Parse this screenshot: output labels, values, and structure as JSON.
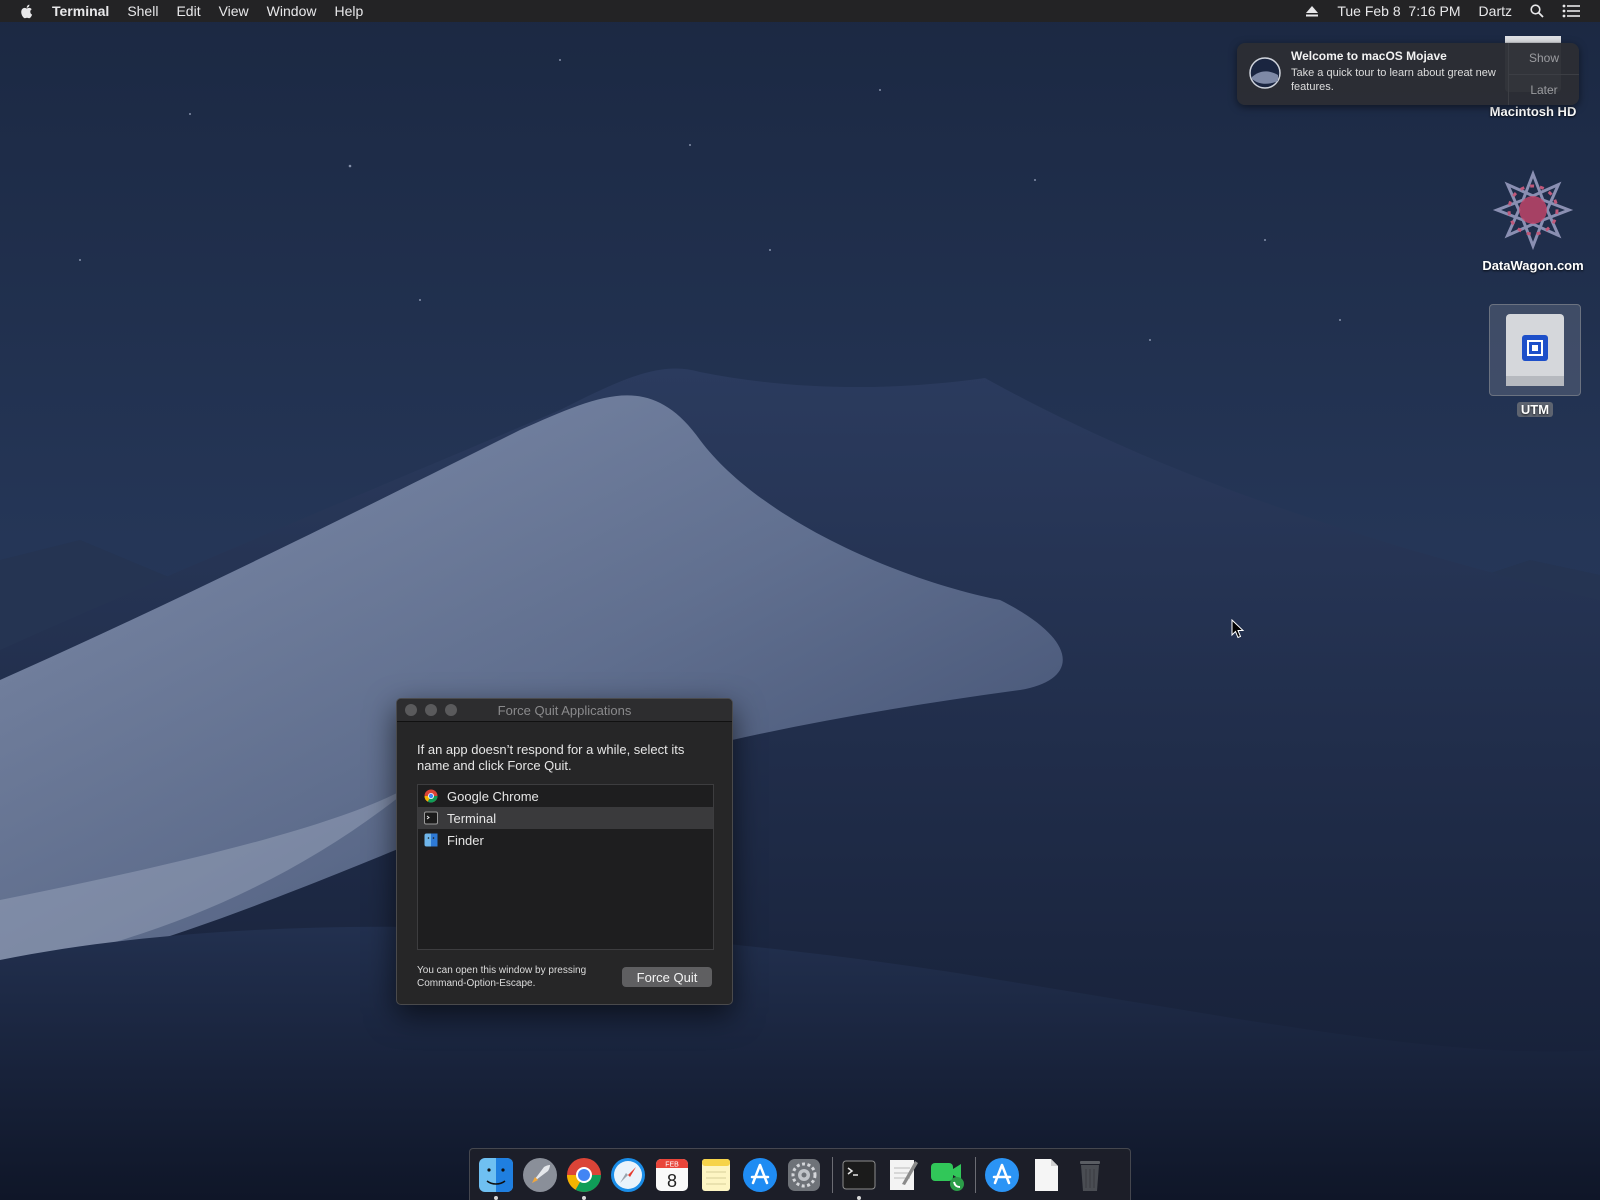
{
  "menubar": {
    "app_name": "Terminal",
    "menus": [
      "Shell",
      "Edit",
      "View",
      "Window",
      "Help"
    ],
    "clock": "Tue Feb 8  7:16 PM",
    "user": "Dartz"
  },
  "notification": {
    "title": "Welcome to macOS Mojave",
    "body": "Take a quick tour to learn about great new features.",
    "show_label": "Show",
    "later_label": "Later"
  },
  "desktop_icons": {
    "macintosh_hd": "Macintosh HD",
    "datawagon": "DataWagon.com",
    "utm": "UTM"
  },
  "force_quit": {
    "title": "Force Quit Applications",
    "description": "If an app doesn’t respond for a while, select its name and click Force Quit.",
    "apps": [
      {
        "name": "Google Chrome",
        "icon": "chrome-icon"
      },
      {
        "name": "Terminal",
        "icon": "terminal-icon"
      },
      {
        "name": "Finder",
        "icon": "finder-icon"
      }
    ],
    "selected_index": 1,
    "hint": "You can open this window by pressing Command-Option-Escape.",
    "button_label": "Force Quit"
  },
  "dock": {
    "calendar_month": "FEB",
    "calendar_day": "8"
  },
  "colors": {
    "menubar_bg": "#232325",
    "window_bg": "#262627",
    "selection": "#3a3a3c",
    "button": "#5f5f61"
  }
}
